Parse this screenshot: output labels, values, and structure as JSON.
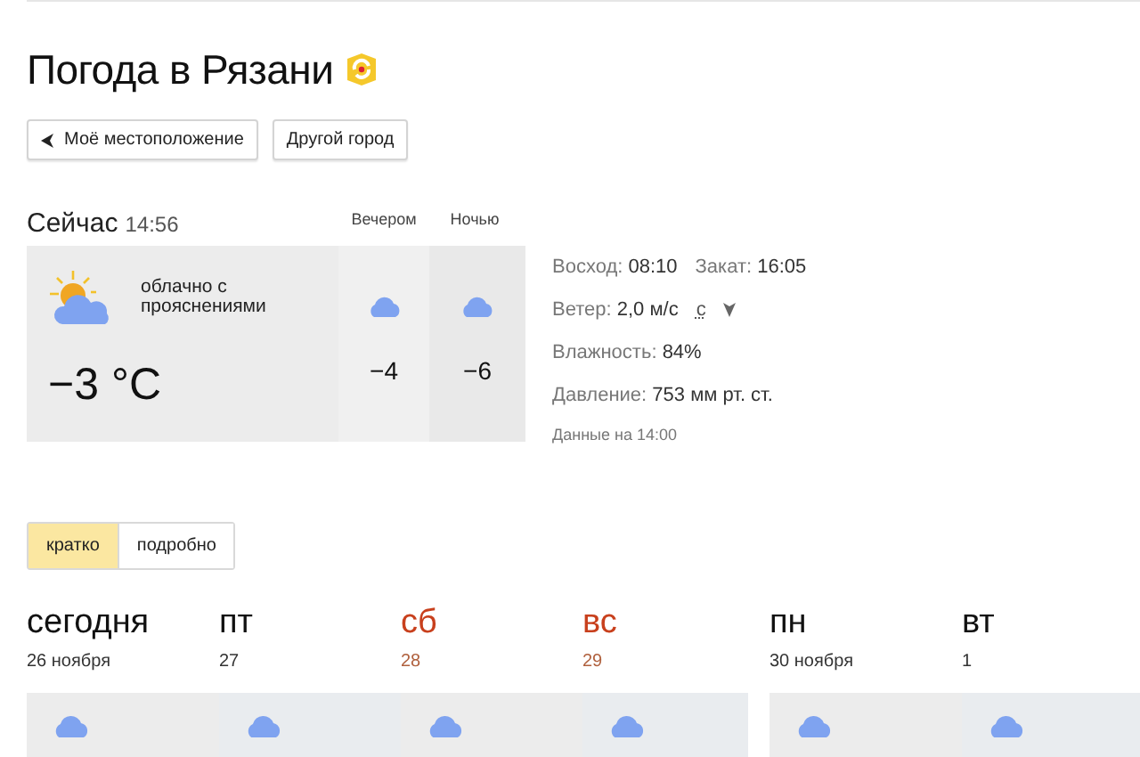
{
  "title": "Погода в Рязани",
  "location_buttons": [
    {
      "label": "Моё местоположение",
      "kind": "locate"
    },
    {
      "label": "Другой город",
      "kind": "plain"
    }
  ],
  "now": {
    "heading": "Сейчас",
    "time": "14:56",
    "condition": "облачно с прояснениями",
    "temperature": "−3 °C"
  },
  "later": [
    {
      "label": "Вечером",
      "temperature": "−4"
    },
    {
      "label": "Ночью",
      "temperature": "−6"
    }
  ],
  "details": [
    {
      "kind": "sun",
      "items": [
        {
          "label": "Восход:",
          "value": "08:10"
        },
        {
          "label": "Закат:",
          "value": "16:05"
        }
      ]
    },
    {
      "kind": "wind",
      "items": [
        {
          "label": "Ветер:",
          "value": "2,0 м/с"
        }
      ],
      "direction": "с"
    },
    {
      "kind": "plain",
      "items": [
        {
          "label": "Влажность:",
          "value": "84%"
        }
      ]
    },
    {
      "kind": "plain",
      "items": [
        {
          "label": "Давление:",
          "value": "753 мм рт. ст."
        }
      ]
    },
    {
      "kind": "note",
      "items": [
        {
          "label": "Данные на 14:00"
        }
      ]
    }
  ],
  "view_tabs": [
    {
      "label": "кратко",
      "selected": true
    },
    {
      "label": "подробно",
      "selected": false
    }
  ],
  "days": [
    [
      {
        "name": "сегодня",
        "date": "26 ноября",
        "weekend": false
      },
      {
        "name": "пт",
        "date": "27",
        "weekend": false
      },
      {
        "name": "сб",
        "date": "28",
        "weekend": true
      },
      {
        "name": "вс",
        "date": "29",
        "weekend": true
      }
    ],
    [
      {
        "name": "пн",
        "date": "30 ноября",
        "weekend": false
      },
      {
        "name": "вт",
        "date": "1",
        "weekend": false
      }
    ]
  ]
}
